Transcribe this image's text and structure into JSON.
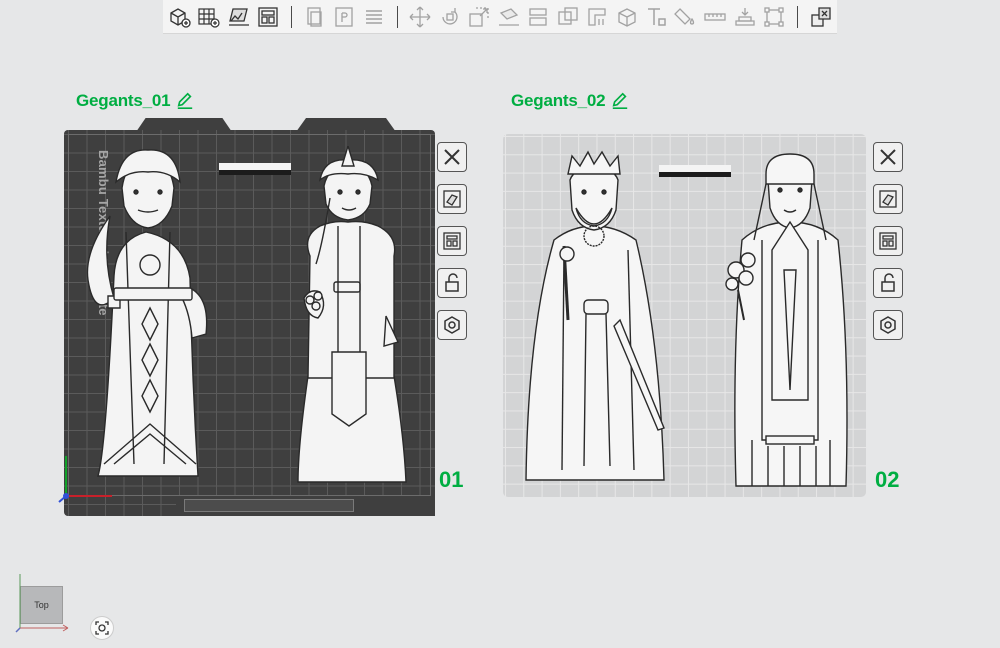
{
  "toolbar": {
    "items": [
      {
        "icon": "add-cube-icon",
        "group": 1
      },
      {
        "icon": "add-plate-icon",
        "group": 1
      },
      {
        "icon": "auto-orient-icon",
        "group": 1
      },
      {
        "icon": "arrange-icon",
        "group": 1
      },
      {
        "icon": "copy-icon",
        "group": 2,
        "dim": true
      },
      {
        "icon": "paste-icon",
        "group": 2,
        "dim": true
      },
      {
        "icon": "layers-icon",
        "group": 2,
        "dim": true
      },
      {
        "icon": "move-icon",
        "group": 3,
        "dim": true
      },
      {
        "icon": "rotate-icon",
        "group": 3,
        "dim": true
      },
      {
        "icon": "scale-icon",
        "group": 3,
        "dim": true
      },
      {
        "icon": "lay-on-face-icon",
        "group": 3,
        "dim": true
      },
      {
        "icon": "cut-icon",
        "group": 3,
        "dim": true
      },
      {
        "icon": "boolean-icon",
        "group": 3,
        "dim": true
      },
      {
        "icon": "support-paint-icon",
        "group": 3,
        "dim": true
      },
      {
        "icon": "seam-paint-icon",
        "group": 3,
        "dim": true
      },
      {
        "icon": "text-icon",
        "group": 3,
        "dim": true
      },
      {
        "icon": "color-paint-icon",
        "group": 3,
        "dim": true
      },
      {
        "icon": "measure-icon",
        "group": 3,
        "dim": true
      },
      {
        "icon": "assembly-icon",
        "group": 3,
        "dim": true
      },
      {
        "icon": "bounding-box-icon",
        "group": 3,
        "dim": true
      },
      {
        "icon": "split-objects-icon",
        "group": 4
      }
    ]
  },
  "plates": [
    {
      "name": "Gegants_01",
      "number": "01",
      "texture_text": "Bambu Textured PEI Plate"
    },
    {
      "name": "Gegants_02",
      "number": "02"
    }
  ],
  "plate_buttons": [
    "close-icon",
    "auto-arrange-icon",
    "plate-settings-icon",
    "lock-icon",
    "plate-hex-icon"
  ],
  "view_cube": {
    "label": "Top"
  },
  "colors": {
    "accent": "#00ae42",
    "plate_dark": "#3f3f3f",
    "plate_light": "#d3d4d5"
  }
}
